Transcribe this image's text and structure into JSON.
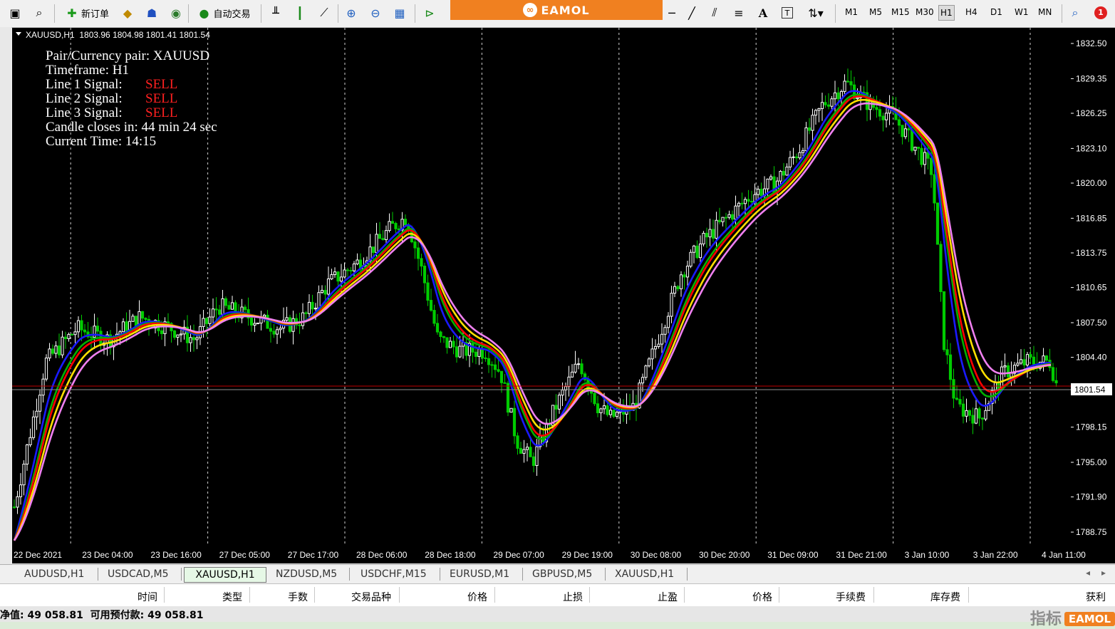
{
  "toolbar": {
    "new_order_label": "新订单",
    "auto_trade_label": "自动交易",
    "timeframes": [
      "M1",
      "M5",
      "M15",
      "M30",
      "H1",
      "H4",
      "D1",
      "W1",
      "MN"
    ],
    "active_timeframe": "H1",
    "notification_count": "1",
    "text_tool": "A",
    "label_tool": "T"
  },
  "banner": {
    "brand": "EAMOL"
  },
  "chart": {
    "header": "XAUUSD,H1  1803.96 1804.98 1801.41 1801.54",
    "info": {
      "pair": "Pair/Currency pair: XAUUSD",
      "timeframe": "Timeframe: H1",
      "line1_label": "Line 1 Signal:",
      "line1_value": "SELL",
      "line2_label": "Line 2 Signal:",
      "line2_value": "SELL",
      "line3_label": "Line 3 Signal:",
      "line3_value": "SELL",
      "candle": "Candle closes in: 44 min 24 sec",
      "time": "Current Time: 14:15"
    },
    "price_ticks": [
      "1832.50",
      "1829.35",
      "1826.25",
      "1823.10",
      "1820.00",
      "1816.85",
      "1813.75",
      "1810.65",
      "1807.50",
      "1804.40",
      "1798.15",
      "1795.00",
      "1791.90",
      "1788.75"
    ],
    "current_price": "1801.54",
    "time_labels": [
      "22 Dec 2021",
      "23 Dec 04:00",
      "23 Dec 16:00",
      "27 Dec 05:00",
      "27 Dec 17:00",
      "28 Dec 06:00",
      "28 Dec 18:00",
      "29 Dec 07:00",
      "29 Dec 19:00",
      "30 Dec 08:00",
      "30 Dec 20:00",
      "31 Dec 09:00",
      "31 Dec 21:00",
      "3 Jan 10:00",
      "3 Jan 22:00",
      "4 Jan 11:00"
    ],
    "colors": {
      "background": "#000000",
      "bull": "#ffffff",
      "bear": "#00cc00",
      "sell": "#ff2020",
      "line_blue": "#1a1aff",
      "line_green": "#00b000",
      "line_red": "#ff0000",
      "line_yellow": "#ffe000",
      "line_pink": "#f080f0",
      "bid_line": "#c00000"
    }
  },
  "tabs": {
    "items": [
      "AUDUSD,H1",
      "USDCAD,M5",
      "XAUUSD,H1",
      "NZDUSD,M5",
      "USDCHF,M15",
      "EURUSD,M1",
      "GBPUSD,M5",
      "XAUUSD,H1"
    ],
    "active_index": 2
  },
  "terminal": {
    "columns": [
      "时间",
      "类型",
      "手数",
      "交易品种",
      "价格",
      "止损",
      "止盈",
      "价格",
      "手续费",
      "库存费",
      "获利"
    ],
    "status": "净值: 49 058.81  可用预付款: 49 058.81"
  },
  "watermark": {
    "text": "指标",
    "brand": "EAMOL"
  }
}
